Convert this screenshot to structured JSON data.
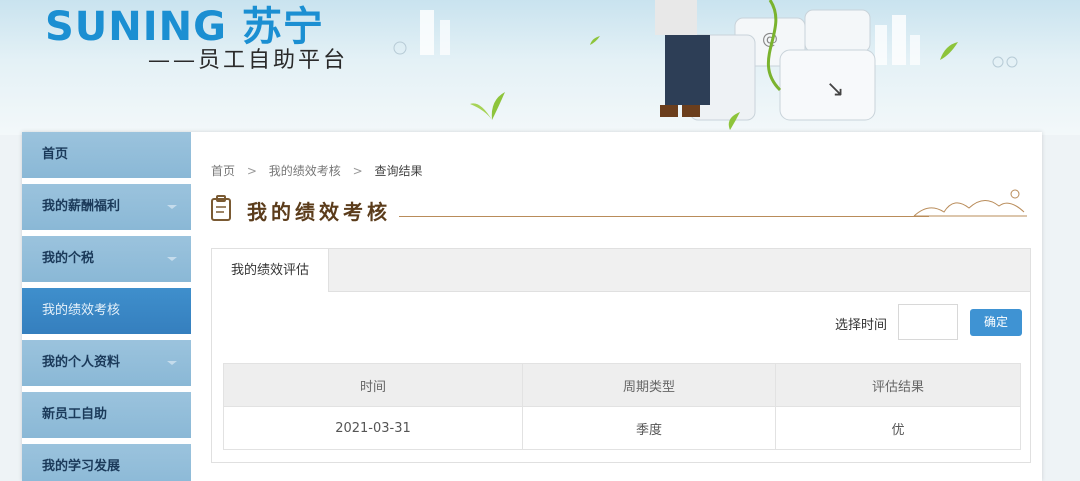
{
  "header": {
    "logo_text": "SUNING 苏宁",
    "subtitle": "——员工自助平台"
  },
  "sidebar": {
    "items": [
      {
        "label": "首页",
        "has_arrow": false,
        "active": false
      },
      {
        "label": "我的薪酬福利",
        "has_arrow": true,
        "active": false
      },
      {
        "label": "我的个税",
        "has_arrow": true,
        "active": false
      },
      {
        "label": "我的绩效考核",
        "has_arrow": false,
        "active": true
      },
      {
        "label": "我的个人资料",
        "has_arrow": true,
        "active": false
      },
      {
        "label": "新员工自助",
        "has_arrow": false,
        "active": false
      },
      {
        "label": "我的学习发展",
        "has_arrow": false,
        "active": false
      }
    ]
  },
  "breadcrumb": {
    "items": [
      "首页",
      "我的绩效考核",
      "查询结果"
    ],
    "separator": ">"
  },
  "page_title": "我的绩效考核",
  "tabs": [
    {
      "label": "我的绩效评估",
      "active": true
    }
  ],
  "filter": {
    "label": "选择时间",
    "value": "",
    "placeholder": "",
    "confirm_label": "确定"
  },
  "table": {
    "headers": [
      "时间",
      "周期类型",
      "评估结果"
    ],
    "rows": [
      [
        "2021-03-31",
        "季度",
        "优"
      ]
    ]
  },
  "colors": {
    "brand": "#1b8fd2",
    "nav_bg": "#8ab8d6",
    "nav_active": "#357fbe",
    "button": "#3f93d3",
    "title": "#5b3c1b"
  },
  "icons": {
    "title_icon": "clipboard-icon",
    "nav_arrow": "chevron-down-icon"
  }
}
